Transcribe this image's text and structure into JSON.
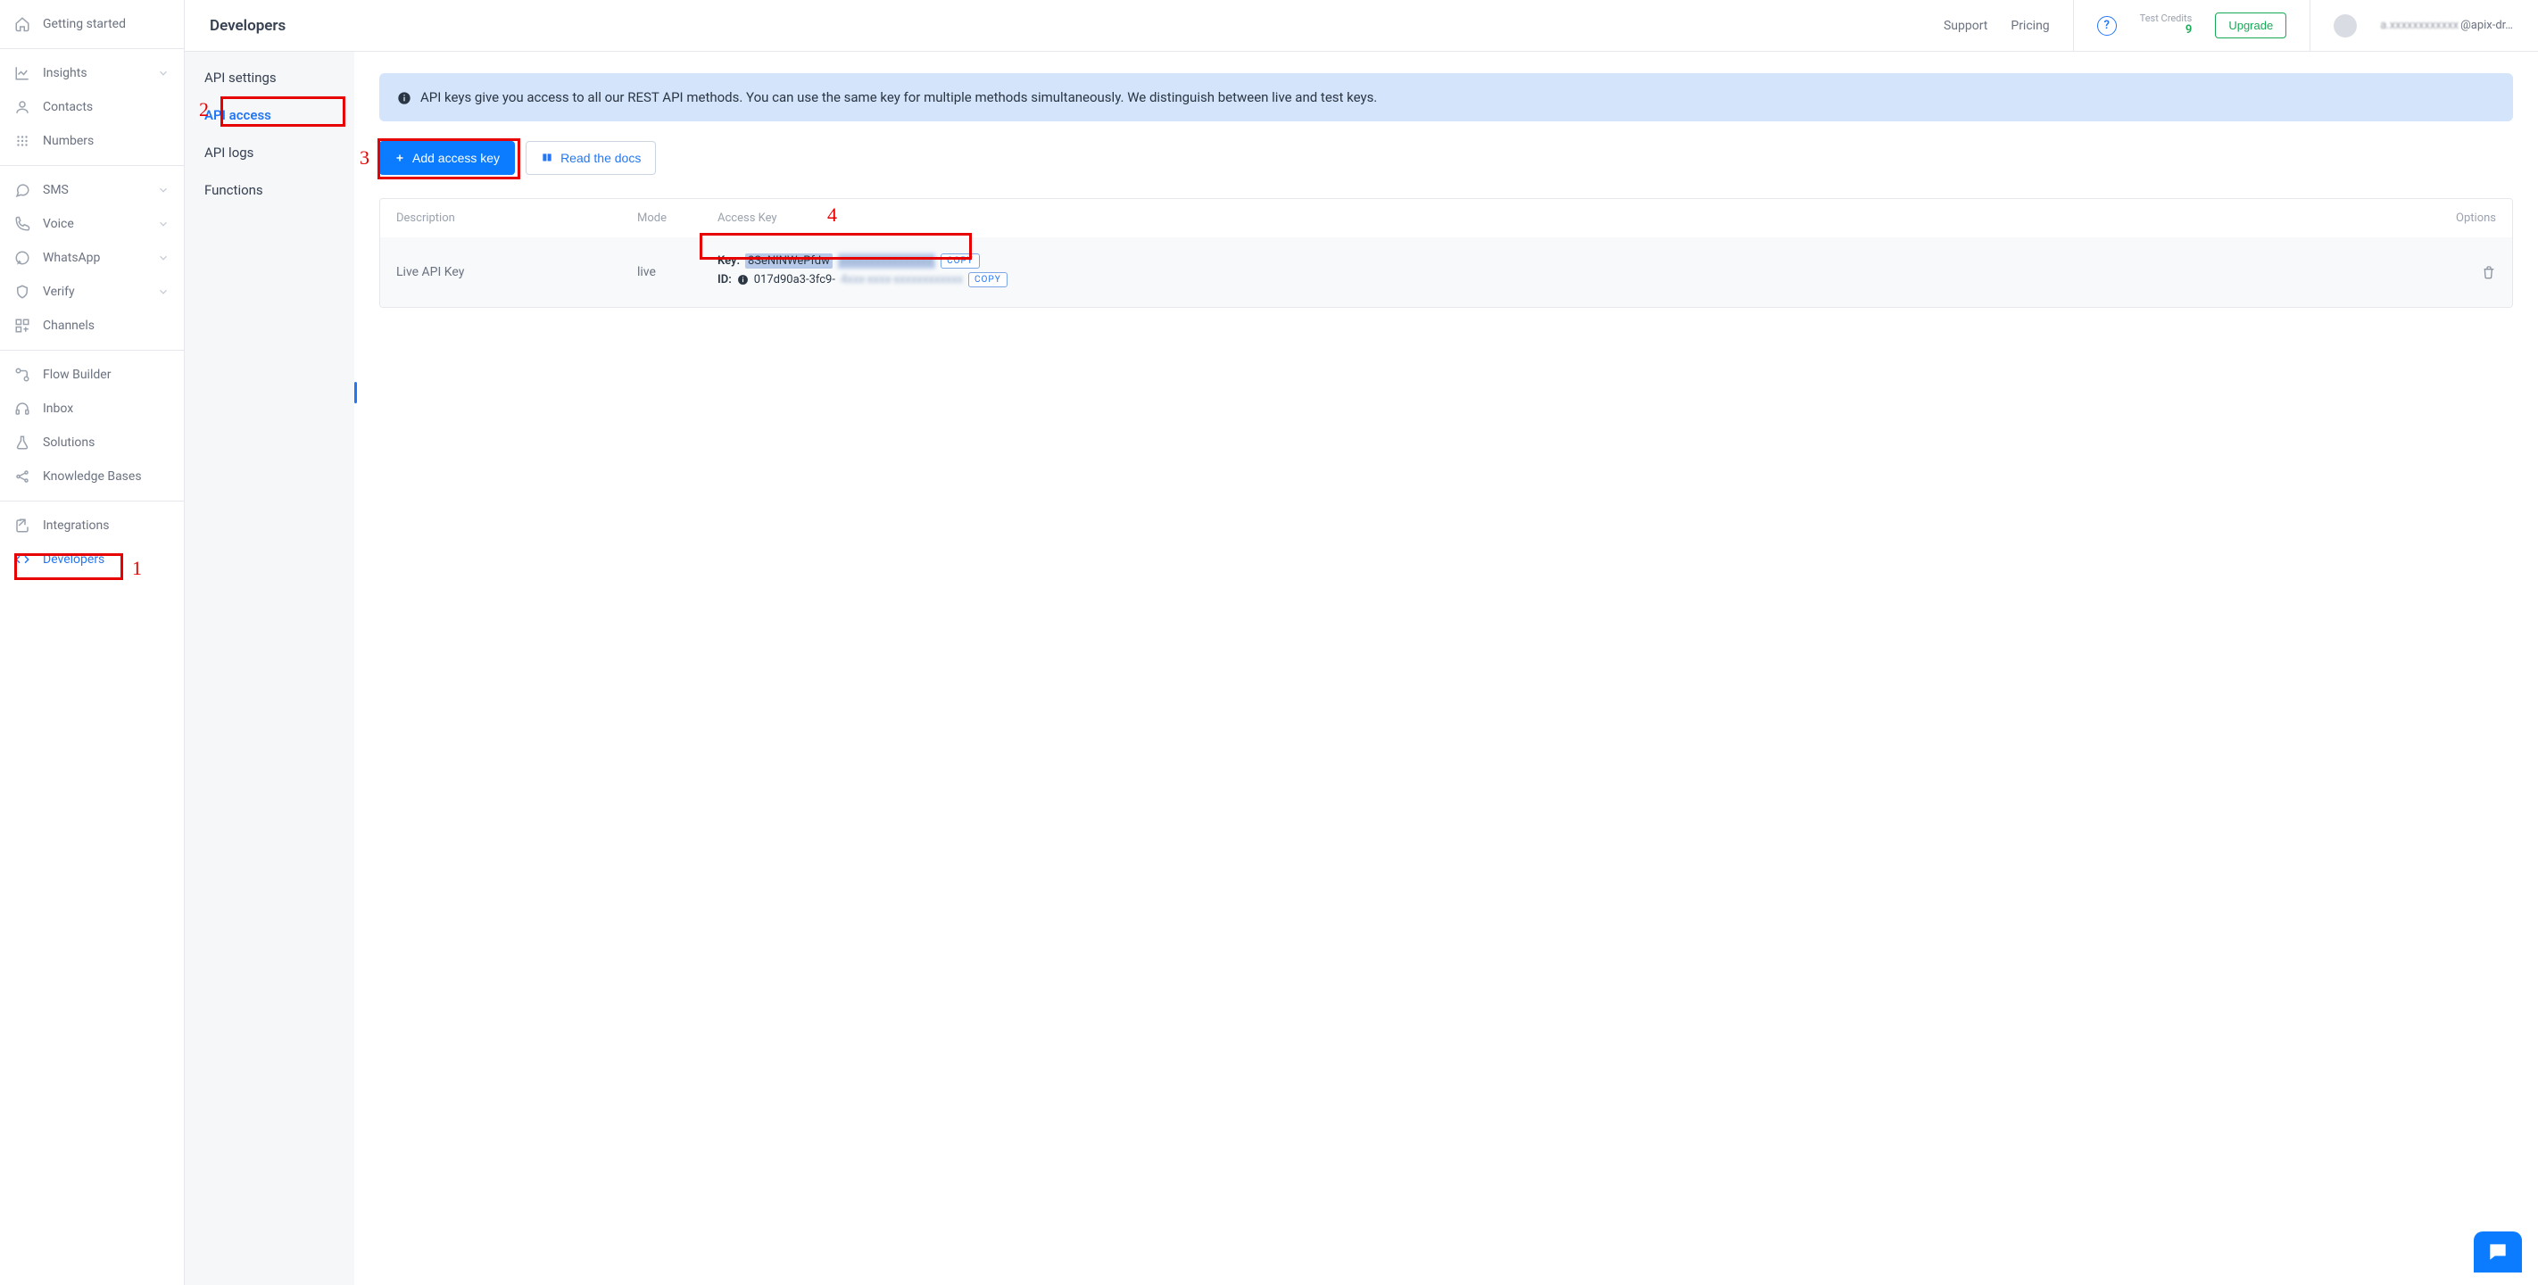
{
  "sidebar": {
    "group_top": [
      {
        "label": "Getting started"
      }
    ],
    "group_insights": [
      {
        "label": "Insights",
        "expandable": true
      },
      {
        "label": "Contacts"
      },
      {
        "label": "Numbers"
      }
    ],
    "group_channels": [
      {
        "label": "SMS",
        "expandable": true
      },
      {
        "label": "Voice",
        "expandable": true
      },
      {
        "label": "WhatsApp",
        "expandable": true
      },
      {
        "label": "Verify",
        "expandable": true
      },
      {
        "label": "Channels"
      }
    ],
    "group_tools": [
      {
        "label": "Flow Builder"
      },
      {
        "label": "Inbox"
      },
      {
        "label": "Solutions"
      },
      {
        "label": "Knowledge Bases"
      }
    ],
    "group_bottom": [
      {
        "label": "Integrations"
      },
      {
        "label": "Developers"
      }
    ]
  },
  "header": {
    "title": "Developers",
    "support": "Support",
    "pricing": "Pricing",
    "help_glyph": "?",
    "credits_label": "Test Credits",
    "credits_value": "9",
    "upgrade": "Upgrade",
    "user_email_blur": "a.xxxxxxxxxxxx",
    "user_email_tail": "@apix-dr…"
  },
  "subnav": {
    "items": [
      {
        "label": "API settings"
      },
      {
        "label": "API access"
      },
      {
        "label": "API logs"
      },
      {
        "label": "Functions"
      }
    ]
  },
  "banner": {
    "text": "API keys give you access to all our REST API methods. You can use the same key for multiple methods simultaneously. We distinguish between live and test keys."
  },
  "buttons": {
    "add_key": "Add access key",
    "docs": "Read the docs"
  },
  "table": {
    "headers": {
      "description": "Description",
      "mode": "Mode",
      "access_key": "Access Key",
      "options": "Options"
    },
    "row": {
      "description": "Live API Key",
      "mode": "live",
      "key_label": "Key:",
      "id_label": "ID:",
      "key_visible": "8SeNINWePfdw",
      "key_hidden": "xxxxxxxxxxxxxxxx",
      "id_visible": "017d90a3-3fc9-",
      "id_hidden": "4xxx-xxxx-xxxxxxxxxxxx",
      "copy": "copy"
    }
  },
  "annotations": {
    "n1": "1",
    "n2": "2",
    "n3": "3",
    "n4": "4"
  }
}
